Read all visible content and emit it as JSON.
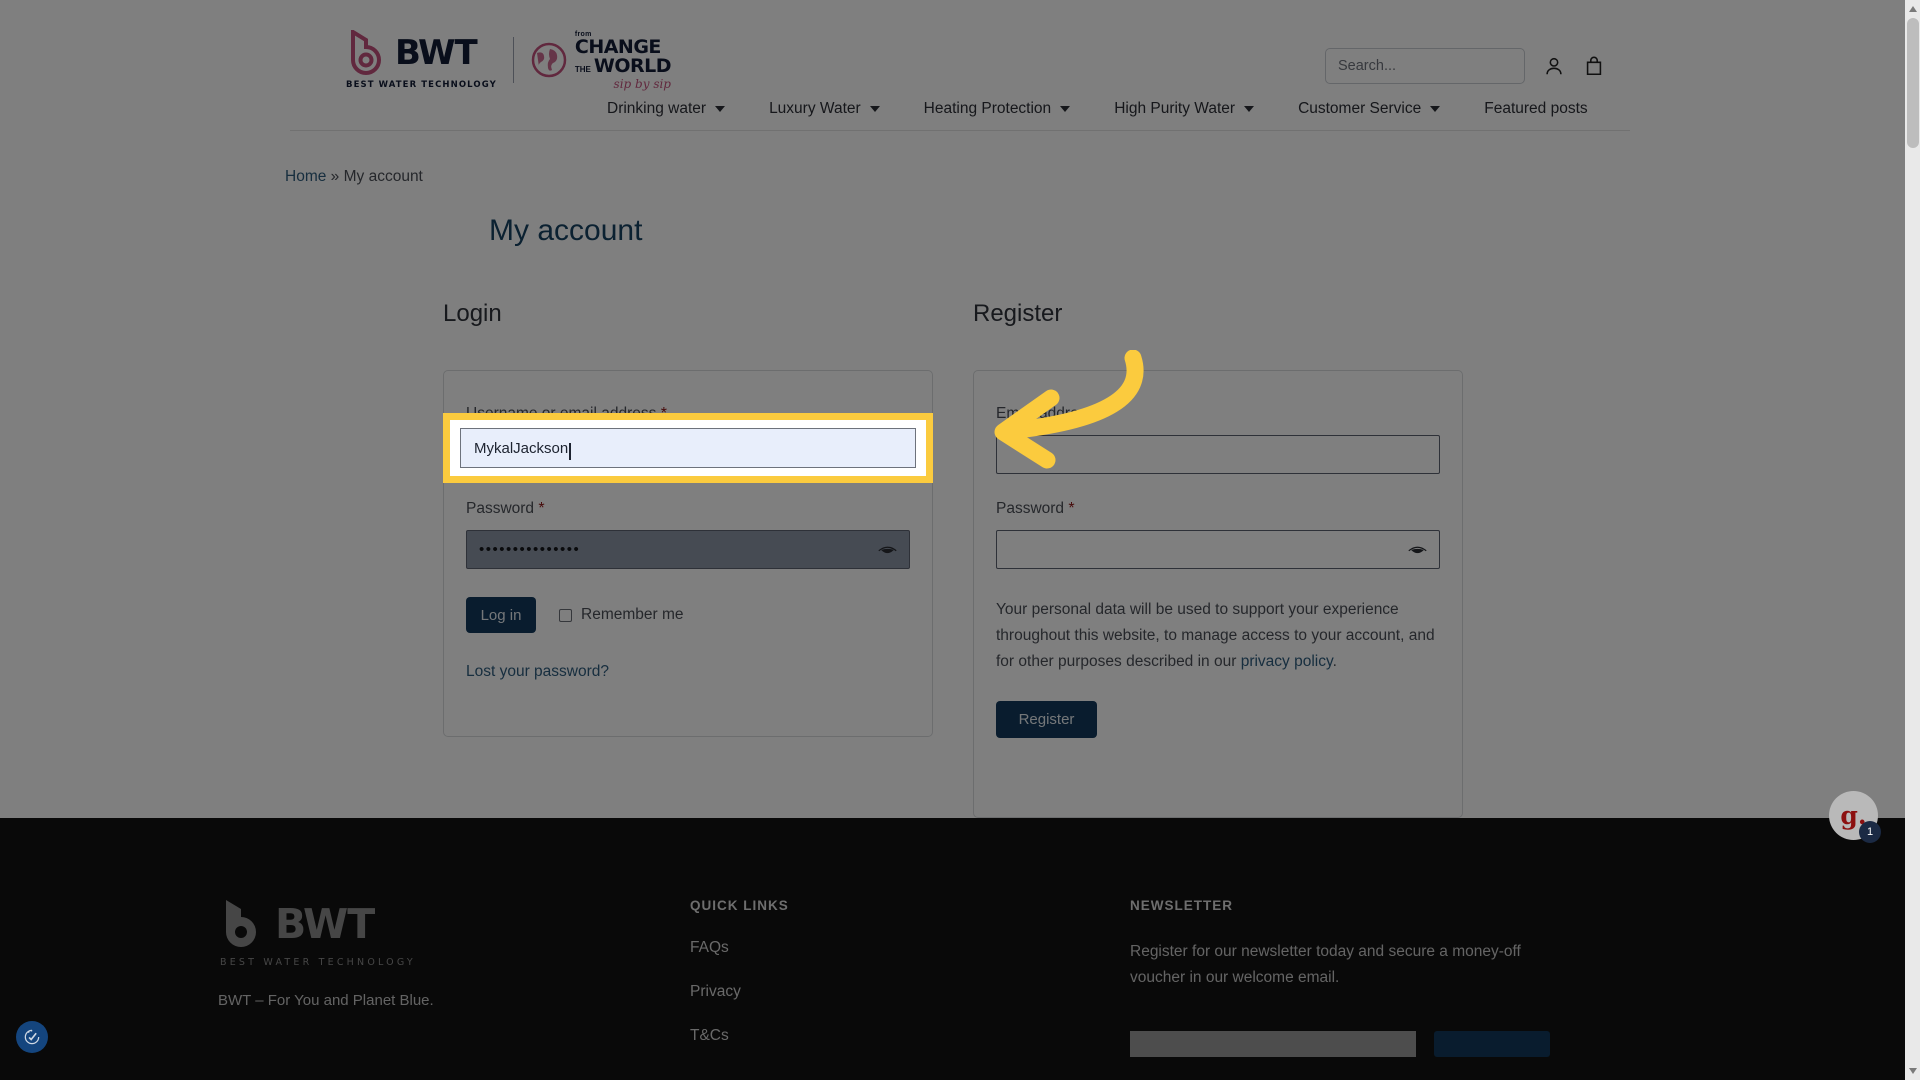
{
  "header": {
    "logo": {
      "brand": "BWT",
      "tagline": "BEST WATER TECHNOLOGY",
      "campaign_top": "from",
      "campaign_line1": "CHANGE",
      "campaign_the": "THE",
      "campaign_line2": "WORLD",
      "campaign_script": "sip by sip"
    },
    "search": {
      "placeholder": "Search...",
      "value": ""
    },
    "account_icon": "user-icon",
    "cart_icon": "shopping-bag-icon"
  },
  "nav": {
    "items": [
      {
        "label": "Drinking water",
        "has_dropdown": true
      },
      {
        "label": "Luxury Water",
        "has_dropdown": true
      },
      {
        "label": "Heating Protection",
        "has_dropdown": true
      },
      {
        "label": "High Purity Water",
        "has_dropdown": true
      },
      {
        "label": "Customer Service",
        "has_dropdown": true
      },
      {
        "label": "Featured posts",
        "has_dropdown": false
      }
    ]
  },
  "breadcrumb": {
    "home": "Home",
    "separator": "»",
    "current": "My account"
  },
  "page_title": "My account",
  "login": {
    "heading": "Login",
    "username_label": "Username or email address",
    "username_required": "*",
    "username_value": "MykalJackson",
    "password_label": "Password",
    "password_required": "*",
    "password_value": "•••••••••••••••",
    "show_password_icon": "eye-icon",
    "submit_label": "Log in",
    "remember_label": "Remember me",
    "remember_checked": false,
    "lost_password_label": "Lost your password?"
  },
  "register": {
    "heading": "Register",
    "email_label": "Email address",
    "email_required": "*",
    "email_value": "",
    "password_label": "Password",
    "password_required": "*",
    "password_value": "",
    "show_password_icon": "eye-icon",
    "privacy_text": "Your personal data will be used to support your experience throughout this website, to manage access to your account, and for other purposes described in our ",
    "privacy_link": "privacy policy",
    "privacy_period": ".",
    "submit_label": "Register"
  },
  "annotation": {
    "highlight_target": "username-or-email-input",
    "highlight_color": "#fbcb3e",
    "arrow_color": "#fbcb3e",
    "arrow_direction": "left"
  },
  "footer": {
    "brand": "BWT",
    "tagline": "BEST WATER TECHNOLOGY",
    "strapline": "BWT – For You and Planet Blue.",
    "quick_links_heading": "QUICK LINKS",
    "quick_links": [
      "FAQs",
      "Privacy",
      "T&Cs"
    ],
    "newsletter_heading": "NEWSLETTER",
    "newsletter_text": "Register for our newsletter today and secure a money-off voucher in our welcome email.",
    "newsletter_input_value": "",
    "newsletter_button_label": ""
  },
  "widgets": {
    "accessibility_icon": "accessibility-icon",
    "chat_label": "g.",
    "chat_badge_count": "1"
  },
  "colors": {
    "brand_navy": "#12395c",
    "brand_pink": "#c2517c",
    "title_blue": "#174263",
    "link_blue": "#2e5d7e",
    "highlight_yellow": "#fbcb3e",
    "footer_bg": "#121212",
    "required_red": "#8b1111"
  }
}
